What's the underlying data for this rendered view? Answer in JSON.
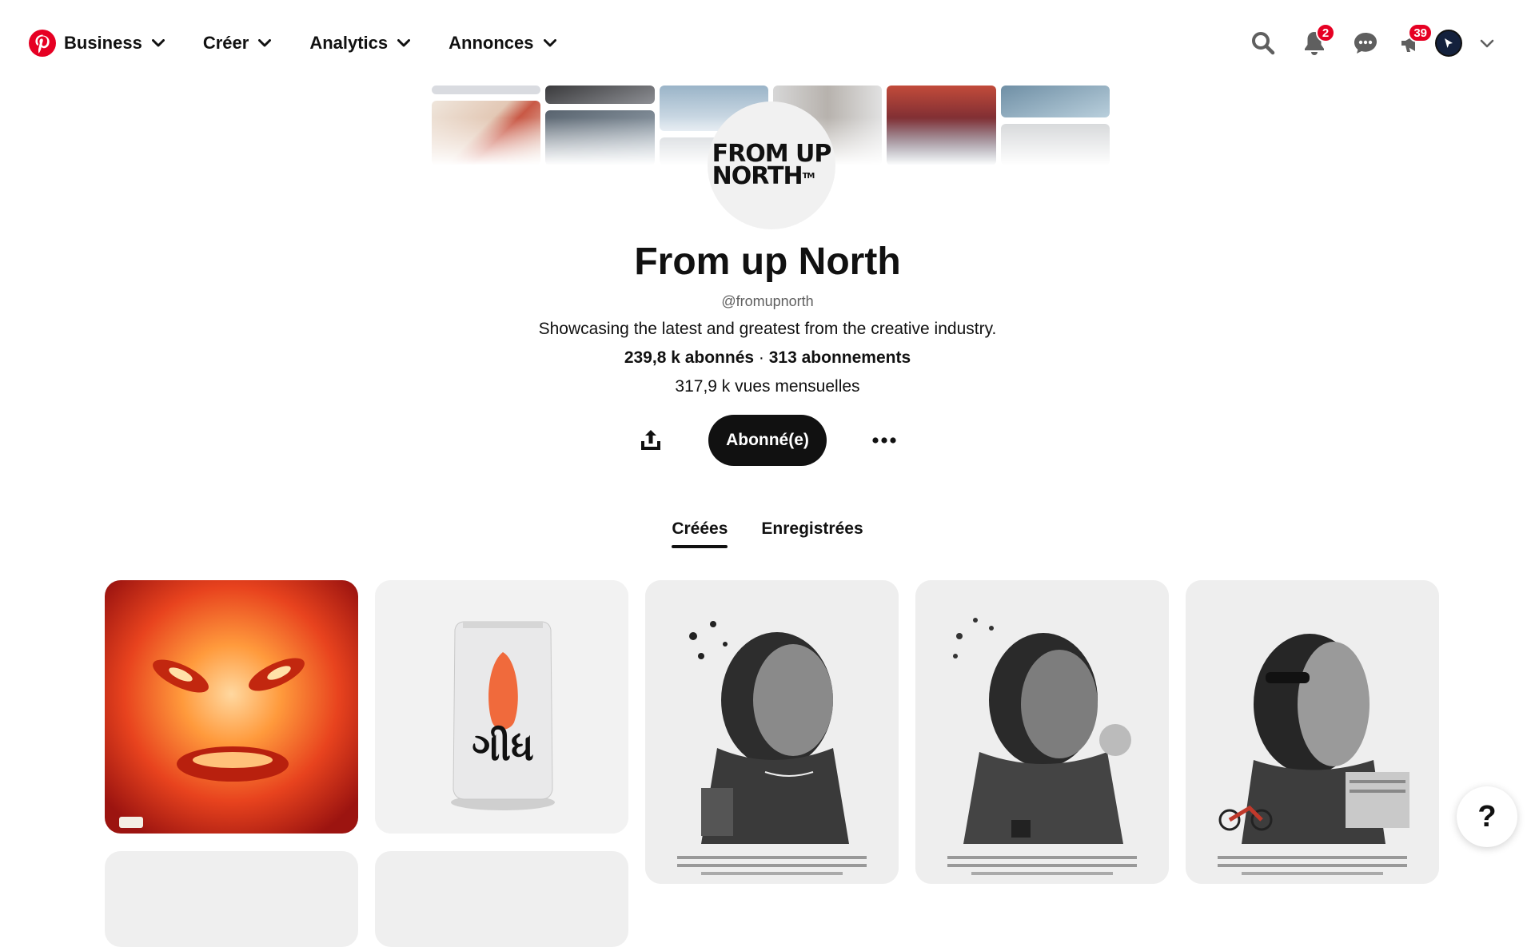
{
  "nav": {
    "brand_label": "Business",
    "items": [
      {
        "label": "Créer"
      },
      {
        "label": "Analytics"
      },
      {
        "label": "Annonces"
      }
    ],
    "notifications_badge": "2",
    "updates_badge": "39"
  },
  "profile": {
    "avatar_text_line1": "FROM UP",
    "avatar_text_line2": "NORTH",
    "avatar_tm": "TM",
    "name": "From up North",
    "handle": "@fromupnorth",
    "bio": "Showcasing the latest and greatest from the creative industry.",
    "followers": "239,8 k abonnés",
    "separator": " · ",
    "following": "313 abonnements",
    "monthly_views": "317,9 k vues mensuelles",
    "follow_button": "Abonné(e)"
  },
  "tabs": [
    {
      "label": "Créées",
      "active": true
    },
    {
      "label": "Enregistrées",
      "active": false
    }
  ],
  "help_label": "?",
  "colors": {
    "brand_red": "#e60023",
    "button_dark": "#111111",
    "muted_text": "#5f5f5f"
  }
}
